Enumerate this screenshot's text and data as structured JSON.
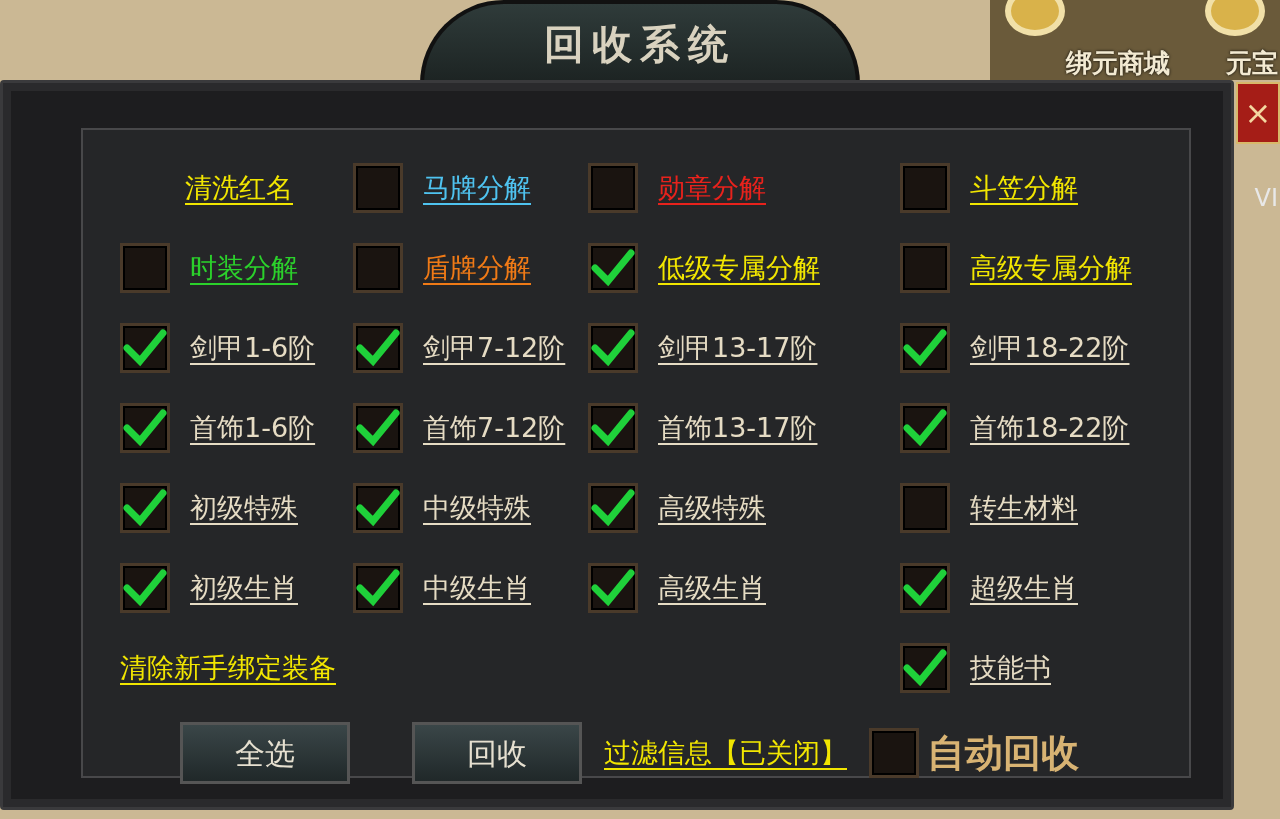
{
  "background": {
    "shop_labels": [
      "绑元商城",
      "元宝"
    ],
    "side_label": "VI"
  },
  "window": {
    "title": "回收系统",
    "close": "×"
  },
  "rows": [
    [
      {
        "kind": "link",
        "label": "清洗红名",
        "color": "#f2e600"
      },
      {
        "kind": "option",
        "label": "马牌分解",
        "color": "#4fc3f0",
        "checked": false
      },
      {
        "kind": "option",
        "label": "勋章分解",
        "color": "#e8221c",
        "checked": false
      },
      {
        "kind": "option",
        "label": "斗笠分解",
        "color": "#f2e600",
        "checked": false
      }
    ],
    [
      {
        "kind": "option",
        "label": "时装分解",
        "color": "#2bd12b",
        "checked": false
      },
      {
        "kind": "option",
        "label": "盾牌分解",
        "color": "#f07a16",
        "checked": false
      },
      {
        "kind": "option",
        "label": "低级专属分解",
        "color": "#f2e600",
        "checked": true
      },
      {
        "kind": "option",
        "label": "高级专属分解",
        "color": "#f2e600",
        "checked": false
      }
    ],
    [
      {
        "kind": "option",
        "label": "剑甲1-6阶",
        "color": "#e6dcc4",
        "checked": true
      },
      {
        "kind": "option",
        "label": "剑甲7-12阶",
        "color": "#e6dcc4",
        "checked": true
      },
      {
        "kind": "option",
        "label": "剑甲13-17阶",
        "color": "#e6dcc4",
        "checked": true
      },
      {
        "kind": "option",
        "label": "剑甲18-22阶",
        "color": "#e6dcc4",
        "checked": true
      }
    ],
    [
      {
        "kind": "option",
        "label": "首饰1-6阶",
        "color": "#e6dcc4",
        "checked": true
      },
      {
        "kind": "option",
        "label": "首饰7-12阶",
        "color": "#e6dcc4",
        "checked": true
      },
      {
        "kind": "option",
        "label": "首饰13-17阶",
        "color": "#e6dcc4",
        "checked": true
      },
      {
        "kind": "option",
        "label": "首饰18-22阶",
        "color": "#e6dcc4",
        "checked": true
      }
    ],
    [
      {
        "kind": "option",
        "label": "初级特殊",
        "color": "#e6dcc4",
        "checked": true
      },
      {
        "kind": "option",
        "label": "中级特殊",
        "color": "#e6dcc4",
        "checked": true
      },
      {
        "kind": "option",
        "label": "高级特殊",
        "color": "#e6dcc4",
        "checked": true
      },
      {
        "kind": "option",
        "label": "转生材料",
        "color": "#e6dcc4",
        "checked": false
      }
    ],
    [
      {
        "kind": "option",
        "label": "初级生肖",
        "color": "#e6dcc4",
        "checked": true
      },
      {
        "kind": "option",
        "label": "中级生肖",
        "color": "#e6dcc4",
        "checked": true
      },
      {
        "kind": "option",
        "label": "高级生肖",
        "color": "#e6dcc4",
        "checked": true
      },
      {
        "kind": "option",
        "label": "超级生肖",
        "color": "#e6dcc4",
        "checked": true
      }
    ],
    [
      {
        "kind": "link",
        "label": "清除新手绑定装备",
        "color": "#f2e600"
      },
      {
        "kind": "empty"
      },
      {
        "kind": "empty"
      },
      {
        "kind": "option",
        "label": "技能书",
        "color": "#e6dcc4",
        "checked": true
      }
    ]
  ],
  "footer": {
    "buttons": [
      "全选",
      "回收"
    ],
    "filter_link": "过滤信息【已关闭】",
    "auto_recycle": {
      "label": "自动回收",
      "checked": false
    }
  }
}
